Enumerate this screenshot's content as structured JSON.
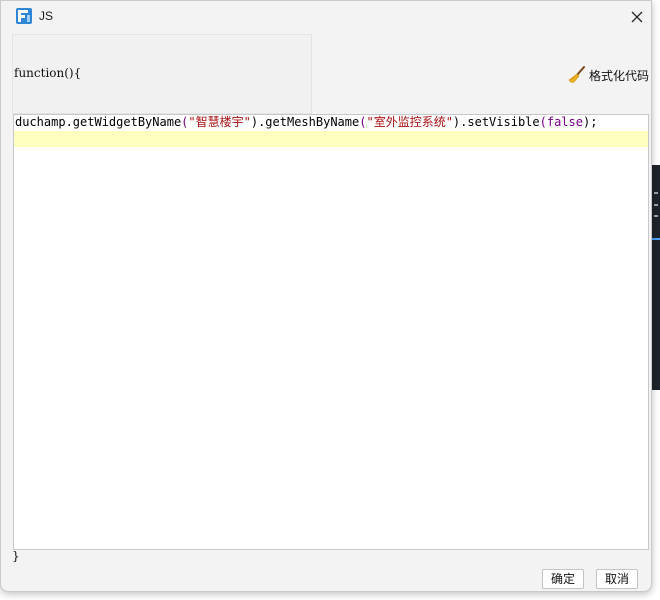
{
  "window": {
    "title": "JS",
    "app_icon": "app-logo-icon",
    "accent_color": "#2f86d8"
  },
  "editor": {
    "header_text": "function(){",
    "footer_text": "}",
    "format_button_label": "格式化代码",
    "format_button_icon": "broom-icon",
    "code": {
      "part1": "duchamp.getWidgetByName",
      "paren1": "(",
      "str1": "\"智慧楼宇\"",
      "part2": ").getMeshByName",
      "paren2": "(",
      "str2": "\"室外监控系统\"",
      "part3": ").setVisible",
      "paren3": "(",
      "kw": "false",
      "part4": ");"
    },
    "active_line_color": "#ffffc0",
    "string_color": "#aa1111",
    "keyword_color": "#770088"
  },
  "buttons": {
    "ok_label": "确定",
    "cancel_label": "取消"
  }
}
